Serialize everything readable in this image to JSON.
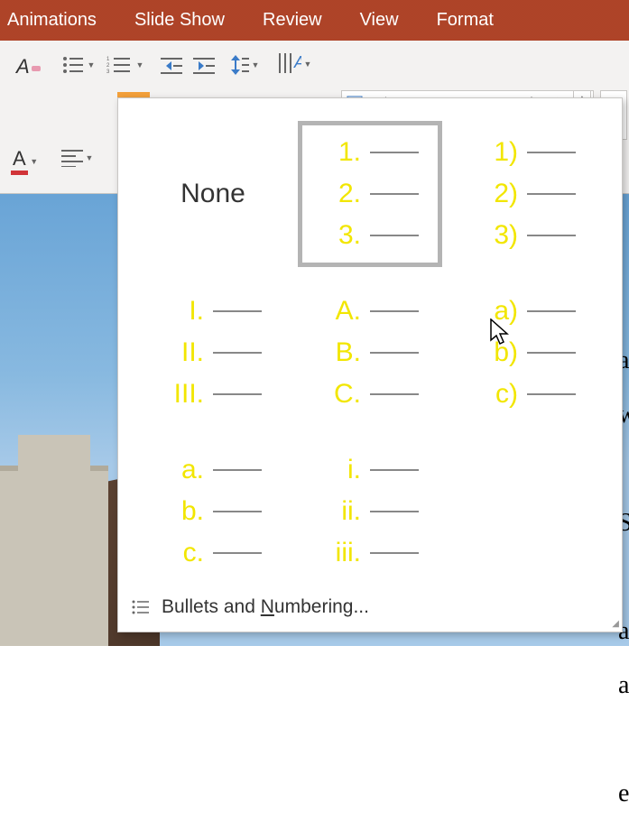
{
  "ribbon": {
    "tabs": [
      "Animations",
      "Slide Show",
      "Review",
      "View",
      "Format"
    ]
  },
  "numbering_gallery": {
    "none_label": "None",
    "options": [
      {
        "id": "none"
      },
      {
        "id": "decimal-period",
        "marks": [
          "1.",
          "2.",
          "3."
        ],
        "selected": true
      },
      {
        "id": "decimal-paren",
        "marks": [
          "1)",
          "2)",
          "3)"
        ]
      },
      {
        "id": "upper-roman",
        "marks": [
          "I.",
          "II.",
          "III."
        ]
      },
      {
        "id": "upper-alpha",
        "marks": [
          "A.",
          "B.",
          "C."
        ]
      },
      {
        "id": "lower-alpha-paren",
        "marks": [
          "a)",
          "b)",
          "c)"
        ]
      },
      {
        "id": "lower-alpha",
        "marks": [
          "a.",
          "b.",
          "c."
        ]
      },
      {
        "id": "lower-roman",
        "marks": [
          "i.",
          "ii.",
          "iii."
        ]
      }
    ],
    "footer_label_pre": "Bullets and ",
    "footer_label_u": "N",
    "footer_label_post": "umbering..."
  },
  "icons": {
    "clear_formatting": "A",
    "font_color": "A"
  }
}
